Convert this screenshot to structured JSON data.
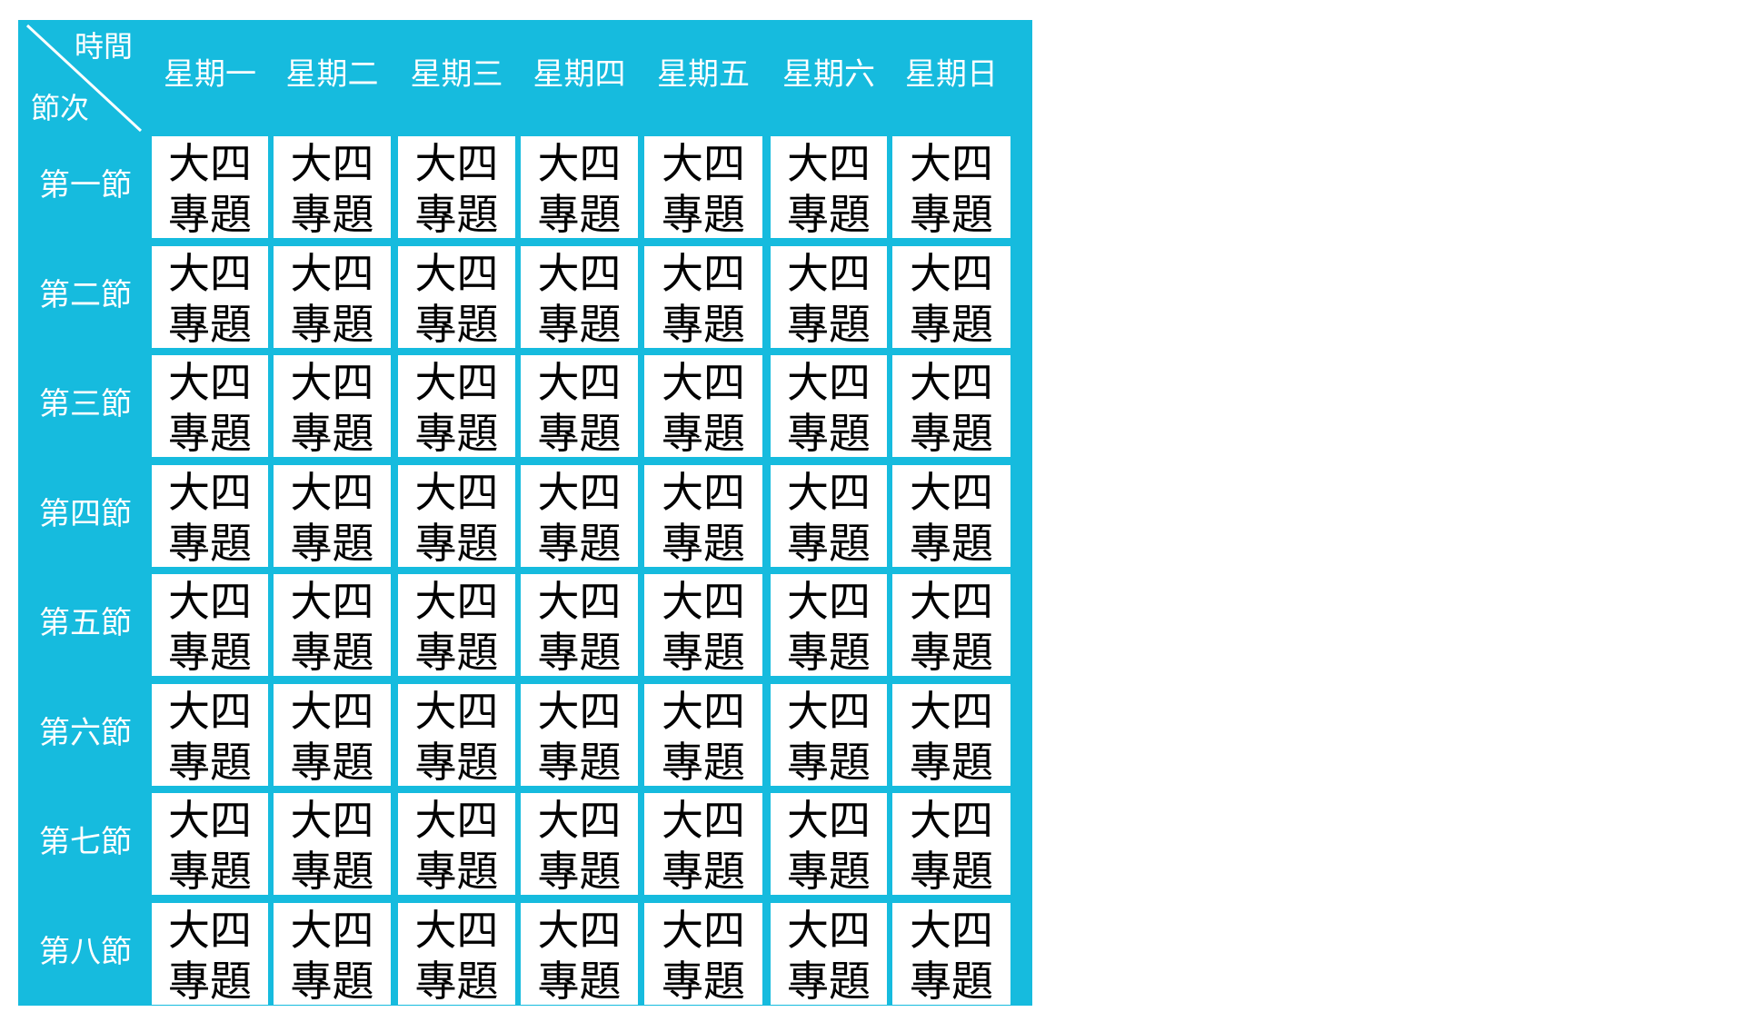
{
  "corner": {
    "time_label": "時間",
    "period_label": "節次"
  },
  "days": [
    "星期一",
    "星期二",
    "星期三",
    "星期四",
    "星期五",
    "星期六",
    "星期日"
  ],
  "periods": [
    "第一節",
    "第二節",
    "第三節",
    "第四節",
    "第五節",
    "第六節",
    "第七節",
    "第八節"
  ],
  "cells": [
    [
      [
        "大四",
        "專題"
      ],
      [
        "大四",
        "專題"
      ],
      [
        "大四",
        "專題"
      ],
      [
        "大四",
        "專題"
      ],
      [
        "大四",
        "專題"
      ],
      [
        "大四",
        "專題"
      ],
      [
        "大四",
        "專題"
      ]
    ],
    [
      [
        "大四",
        "專題"
      ],
      [
        "大四",
        "專題"
      ],
      [
        "大四",
        "專題"
      ],
      [
        "大四",
        "專題"
      ],
      [
        "大四",
        "專題"
      ],
      [
        "大四",
        "專題"
      ],
      [
        "大四",
        "專題"
      ]
    ],
    [
      [
        "大四",
        "專題"
      ],
      [
        "大四",
        "專題"
      ],
      [
        "大四",
        "專題"
      ],
      [
        "大四",
        "專題"
      ],
      [
        "大四",
        "專題"
      ],
      [
        "大四",
        "專題"
      ],
      [
        "大四",
        "專題"
      ]
    ],
    [
      [
        "大四",
        "專題"
      ],
      [
        "大四",
        "專題"
      ],
      [
        "大四",
        "專題"
      ],
      [
        "大四",
        "專題"
      ],
      [
        "大四",
        "專題"
      ],
      [
        "大四",
        "專題"
      ],
      [
        "大四",
        "專題"
      ]
    ],
    [
      [
        "大四",
        "專題"
      ],
      [
        "大四",
        "專題"
      ],
      [
        "大四",
        "專題"
      ],
      [
        "大四",
        "專題"
      ],
      [
        "大四",
        "專題"
      ],
      [
        "大四",
        "專題"
      ],
      [
        "大四",
        "專題"
      ]
    ],
    [
      [
        "大四",
        "專題"
      ],
      [
        "大四",
        "專題"
      ],
      [
        "大四",
        "專題"
      ],
      [
        "大四",
        "專題"
      ],
      [
        "大四",
        "專題"
      ],
      [
        "大四",
        "專題"
      ],
      [
        "大四",
        "專題"
      ]
    ],
    [
      [
        "大四",
        "專題"
      ],
      [
        "大四",
        "專題"
      ],
      [
        "大四",
        "專題"
      ],
      [
        "大四",
        "專題"
      ],
      [
        "大四",
        "專題"
      ],
      [
        "大四",
        "專題"
      ],
      [
        "大四",
        "專題"
      ]
    ],
    [
      [
        "大四",
        "專題"
      ],
      [
        "大四",
        "專題"
      ],
      [
        "大四",
        "專題"
      ],
      [
        "大四",
        "專題"
      ],
      [
        "大四",
        "專題"
      ],
      [
        "大四",
        "專題"
      ],
      [
        "大四",
        "專題"
      ]
    ]
  ],
  "colors": {
    "table_background": "#16bbde",
    "cell_background": "#ffffff",
    "header_text": "#ffffff",
    "cell_text": "#000000"
  }
}
